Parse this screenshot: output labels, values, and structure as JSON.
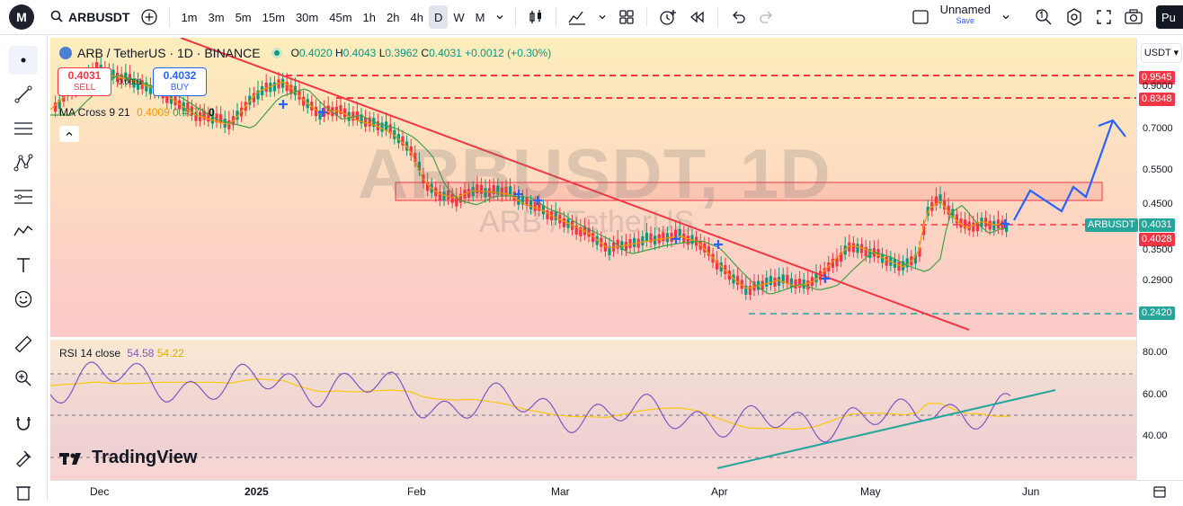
{
  "topbar": {
    "logo": "M",
    "symbol": "ARBUSDT",
    "intervals": [
      "1m",
      "3m",
      "5m",
      "15m",
      "30m",
      "45m",
      "1h",
      "2h",
      "4h",
      "D",
      "W",
      "M"
    ],
    "active_interval": "D",
    "layout_name": "Unnamed",
    "layout_save": "Save",
    "publish": "Pu"
  },
  "legend": {
    "title": "ARB / TetherUS · 1D · BINANCE",
    "open_label": "O",
    "open": "0.4020",
    "high_label": "H",
    "high": "0.4043",
    "low_label": "L",
    "low": "0.3962",
    "close_label": "C",
    "close": "0.4031",
    "change": "+0.0012 (+0.30%)"
  },
  "trade": {
    "sell_price": "0.4031",
    "sell_label": "SELL",
    "buy_price": "0.4032",
    "buy_label": "BUY",
    "spread": "0.0001"
  },
  "ma_legend": {
    "name": "MA Cross 9 21",
    "v1": "0.4009",
    "v2": "0.4071",
    "v3": "0"
  },
  "rsi_legend": {
    "name": "RSI 14 close",
    "v1": "54.58",
    "v2": "54.22"
  },
  "watermark": {
    "main": "ARBUSDT, 1D",
    "sub": "ARB / TetherUS"
  },
  "brand": "TradingView",
  "price_axis": {
    "currency": "USDT",
    "ticks": [
      "0.9000",
      "0.7000",
      "0.5500",
      "0.4500",
      "0.3500",
      "0.2900"
    ],
    "labels": {
      "resist1": "0.9545",
      "resist2": "0.8348",
      "symbol_tag": "ARBUSDT",
      "last": "0.4031",
      "red": "0.4028",
      "support": "0.2420"
    }
  },
  "rsi_axis": {
    "ticks": [
      "80.00",
      "60.00",
      "40.00"
    ]
  },
  "time_axis": {
    "labels": [
      "Dec",
      "2025",
      "Feb",
      "Mar",
      "Apr",
      "May",
      "Jun"
    ]
  },
  "colors": {
    "up": "#089981",
    "down": "#f23645",
    "ma_fast": "#ff9800",
    "ma_slow": "#43a047",
    "rsi": "#7e57c2",
    "rsi_ma": "#f9c80e",
    "trend_red": "#f23645",
    "trend_green": "#26a69a",
    "forecast": "#2962ff"
  }
}
